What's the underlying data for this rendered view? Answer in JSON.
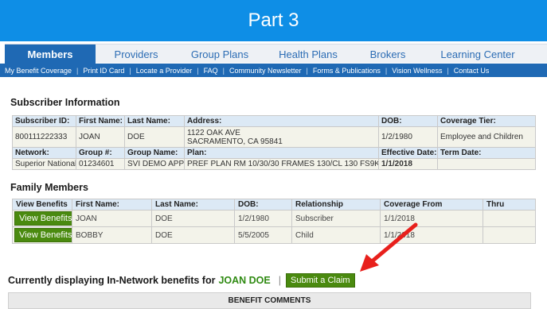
{
  "banner": {
    "title": "Part 3"
  },
  "main_nav": {
    "tabs": [
      {
        "label": "Members",
        "active": true
      },
      {
        "label": "Providers"
      },
      {
        "label": "Group Plans"
      },
      {
        "label": "Health Plans"
      },
      {
        "label": "Brokers"
      },
      {
        "label": "Learning Center"
      }
    ]
  },
  "sub_nav": {
    "items": [
      "My Benefit Coverage",
      "Print ID Card",
      "Locate a Provider",
      "FAQ",
      "Community Newsletter",
      "Forms & Publications",
      "Vision Wellness",
      "Contact Us"
    ]
  },
  "subscriber": {
    "title": "Subscriber Information",
    "headers1": [
      "Subscriber ID:",
      "First Name:",
      "Last Name:",
      "Address:",
      "DOB:",
      "Coverage Tier:"
    ],
    "row1": {
      "subscriber_id": "800111222333",
      "first_name": "JOAN",
      "last_name": "DOE",
      "address_line1": "1122 OAK AVE",
      "address_line2": "SACRAMENTO, CA 95841",
      "dob": "1/2/1980",
      "coverage_tier": "Employee and Children"
    },
    "headers2": [
      "Network:",
      "Group #:",
      "Group Name:",
      "Plan:",
      "Effective Date:",
      "Term Date:"
    ],
    "row2": {
      "network": "Superior National",
      "group_number": "01234601",
      "group_name": "SVI DEMO APP",
      "plan": "PREF PLAN RM 10/30/30 FRAMES 130/CL 130 FS9K",
      "effective_date": "1/1/2018",
      "term_date": ""
    }
  },
  "family": {
    "title": "Family Members",
    "headers": [
      "View Benefits",
      "First Name:",
      "Last Name:",
      "DOB:",
      "Relationship",
      "Coverage From",
      "Thru"
    ],
    "button_label": "View Benefits",
    "rows": [
      {
        "first_name": "JOAN",
        "last_name": "DOE",
        "dob": "1/2/1980",
        "relationship": "Subscriber",
        "coverage_from": "1/1/2018",
        "thru": ""
      },
      {
        "first_name": "BOBBY",
        "last_name": "DOE",
        "dob": "5/5/2005",
        "relationship": "Child",
        "coverage_from": "1/1/2018",
        "thru": ""
      }
    ]
  },
  "current": {
    "prefix": "Currently displaying In-Network benefits for",
    "name": "JOAN DOE",
    "separator": "|",
    "claim_button": "Submit a Claim"
  },
  "comments": {
    "title": "BENEFIT COMMENTS"
  },
  "colors": {
    "banner": "#0e8ee6",
    "nav_active": "#1f69b4",
    "button_green": "#4a8a0f",
    "arrow_red": "#e8201c"
  }
}
